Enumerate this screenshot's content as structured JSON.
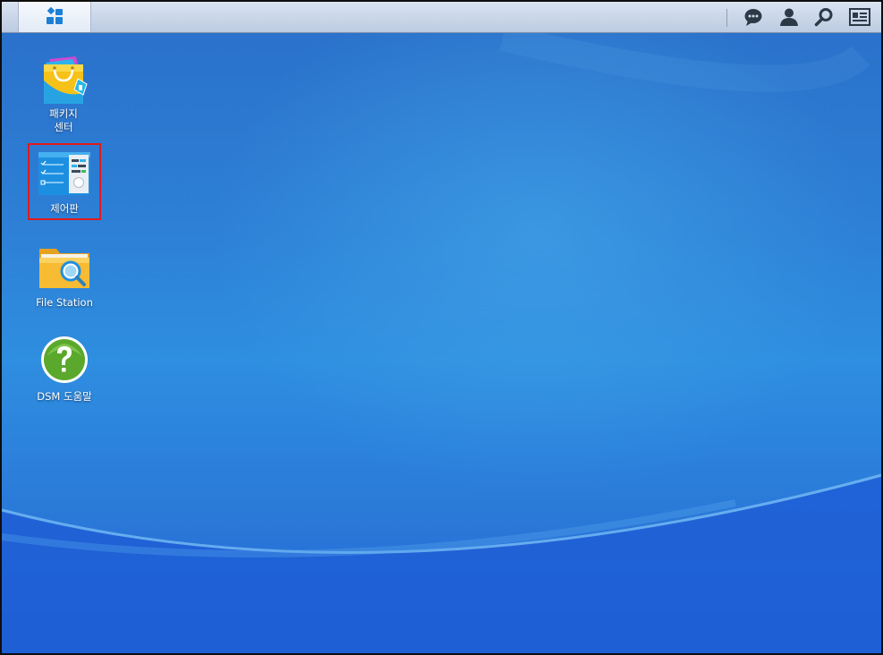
{
  "taskbar": {
    "main_menu_icon": "main-menu-icon",
    "right_icons": [
      "notification-icon",
      "user-icon",
      "search-icon",
      "widgets-icon"
    ]
  },
  "desktop": {
    "shortcuts": [
      {
        "label_line1": "패키지",
        "label_line2": "센터",
        "icon": "package-center-icon"
      },
      {
        "label_line1": "제어판",
        "icon": "control-panel-icon",
        "selected": true
      },
      {
        "label_line1": "File Station",
        "icon": "file-station-icon"
      },
      {
        "label_line1": "DSM 도움말",
        "icon": "help-icon"
      }
    ]
  },
  "colors": {
    "taskbar": "#c8d5e8",
    "desktop_blue": "#2d80d6",
    "highlight": "#e01b1b",
    "help_green": "#5aa82c"
  }
}
